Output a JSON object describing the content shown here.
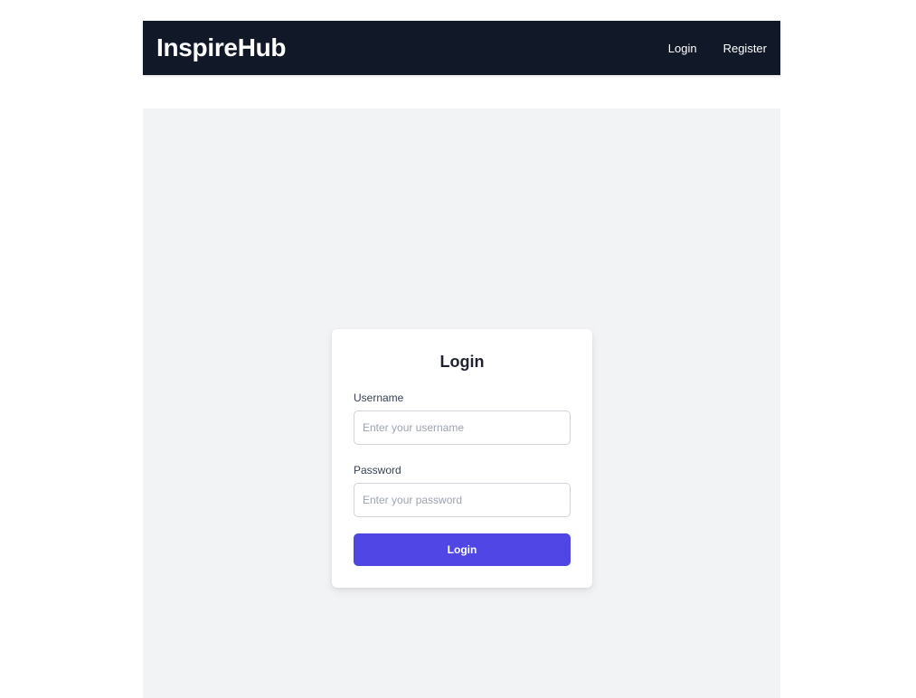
{
  "navbar": {
    "brand": "InspireHub",
    "links": [
      {
        "label": "Login"
      },
      {
        "label": "Register"
      }
    ]
  },
  "login_form": {
    "title": "Login",
    "username": {
      "label": "Username",
      "placeholder": "Enter your username",
      "value": ""
    },
    "password": {
      "label": "Password",
      "placeholder": "Enter your password",
      "value": ""
    },
    "submit_label": "Login"
  },
  "colors": {
    "navbar_bg": "#111827",
    "page_bg": "#f2f3f5",
    "primary_button": "#4f46e5"
  }
}
